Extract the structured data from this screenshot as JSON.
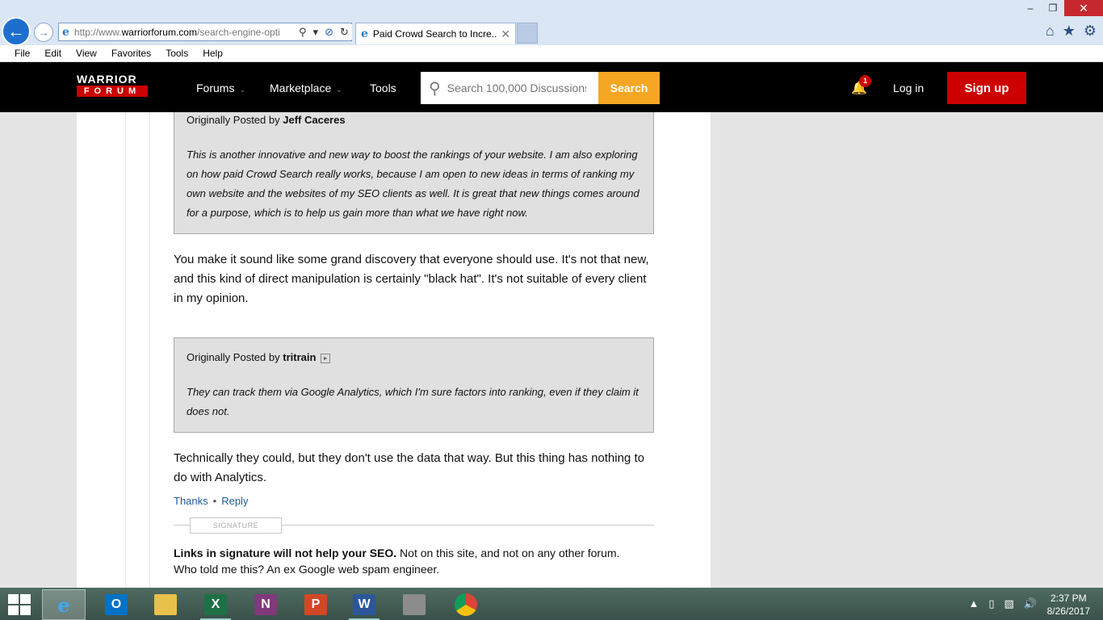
{
  "browser": {
    "address": {
      "domain_prefix": "http://www.",
      "domain": "warriorforum.com",
      "rest": "/search-engine-opti"
    },
    "tab_title": "Paid Crowd Search to Incre...",
    "menu": [
      "File",
      "Edit",
      "View",
      "Favorites",
      "Tools",
      "Help"
    ]
  },
  "site": {
    "logo_line1": "WARRIOR",
    "logo_line2": "FORUM",
    "nav": {
      "forums": "Forums",
      "marketplace": "Marketplace",
      "tools": "Tools"
    },
    "search_placeholder": "Search 100,000 Discussions",
    "search_button": "Search",
    "notification_count": "1",
    "login": "Log in",
    "signup": "Sign up"
  },
  "post": {
    "quote1": {
      "prefix": "Originally Posted by",
      "author": "Jeff Caceres",
      "text": "This is another innovative and new way to boost the rankings of your website. I am also exploring on how paid Crowd Search really works, because I am open to new ideas in terms of ranking my own website and the websites of my SEO clients as well. It is great that new things comes around for a purpose, which is to help us gain more than what we have right now."
    },
    "reply1": "You make it sound like some grand discovery that everyone should use. It's not that new, and this kind of direct manipulation is certainly \"black hat\". It's not suitable of every client in my opinion.",
    "quote2": {
      "prefix": "Originally Posted by",
      "author": "tritrain",
      "text": "They can track them via Google Analytics, which I'm sure factors into ranking, even if they claim it does not."
    },
    "reply2": "Technically they could, but they don't use the data that way. But this thing has nothing to do with Analytics.",
    "actions": {
      "thanks": "Thanks",
      "separator": "•",
      "reply": "Reply"
    },
    "signature_label": "SIGNATURE",
    "signature_bold": "Links in signature will not help your SEO.",
    "signature_rest": " Not on this site, and not on any other forum.",
    "signature_line2": "Who told me this? An ex Google web spam engineer."
  },
  "taskbar": {
    "apps": {
      "outlook": "O",
      "excel": "X",
      "onenote": "N",
      "powerpoint": "P",
      "word": "W"
    },
    "time": "2:37 PM",
    "date": "8/26/2017"
  }
}
